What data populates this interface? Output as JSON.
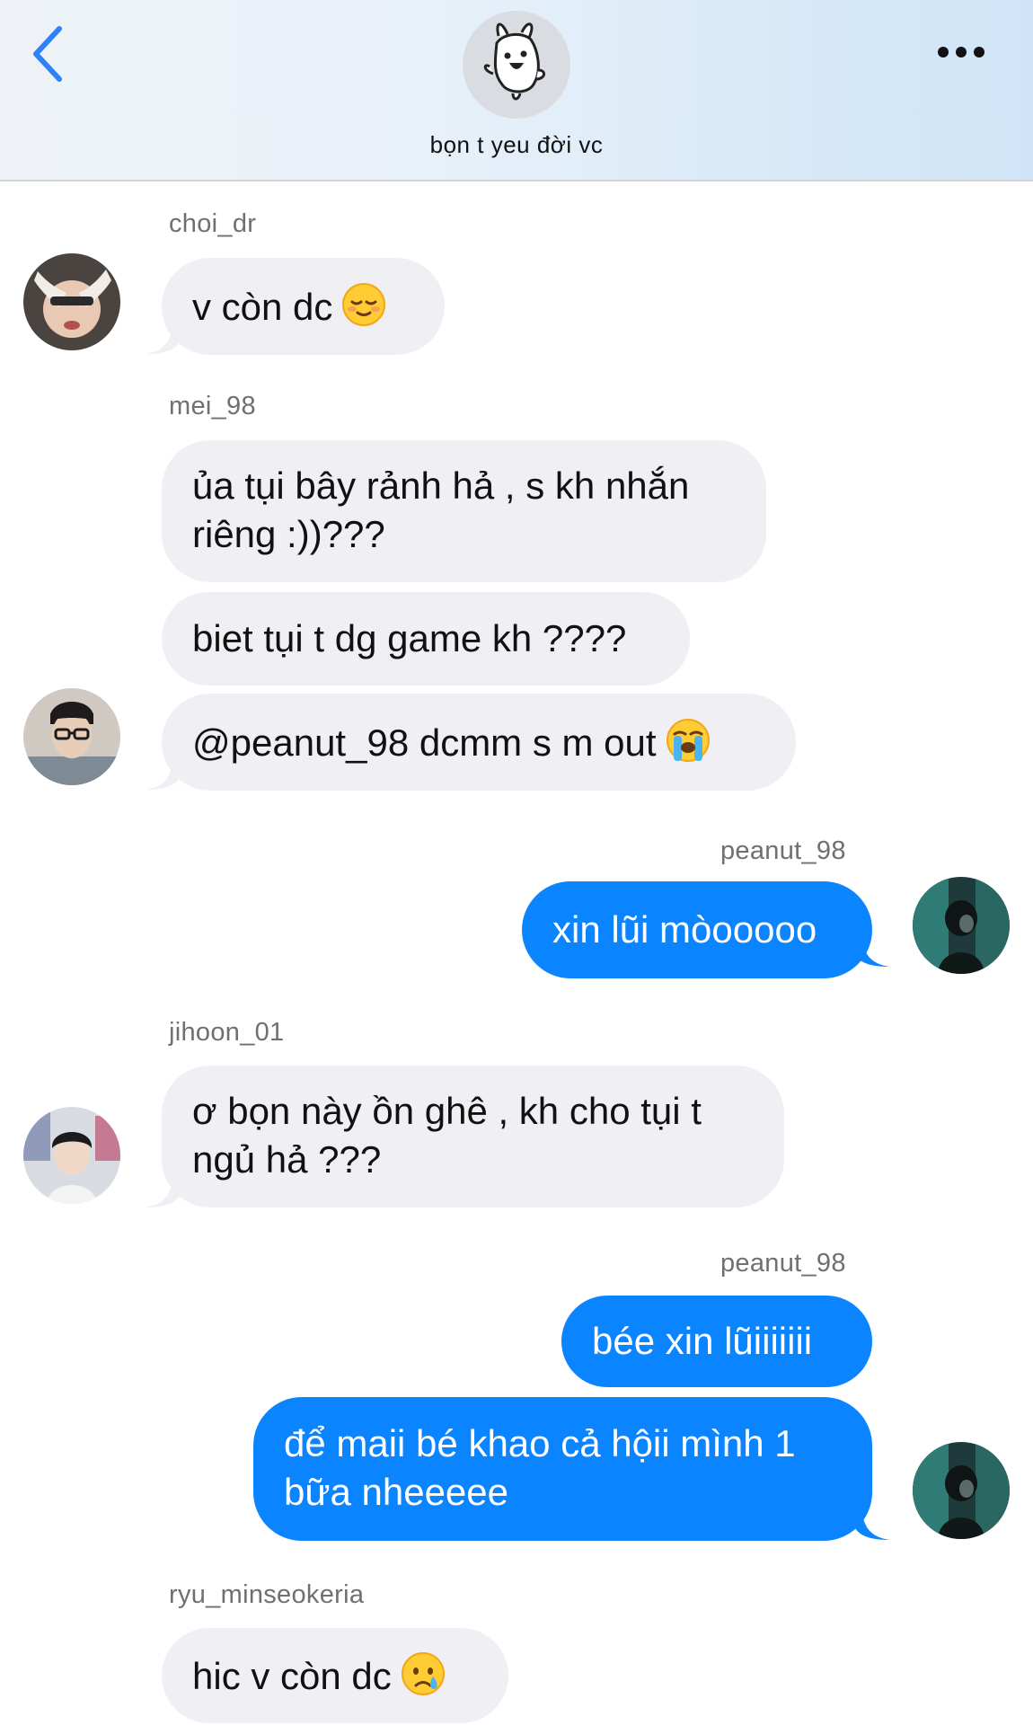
{
  "header": {
    "title": "bọn t yeu đời vc",
    "back_icon": "chevron-left-icon",
    "more_icon": "ellipsis-icon",
    "accent": "#2d83f5"
  },
  "colors": {
    "incoming_bubble": "#efeff4",
    "outgoing_bubble": "#0b84ff",
    "username": "#6f6f74"
  },
  "messages": [
    {
      "sender": "choi_dr",
      "lines": [
        "v còn dc"
      ],
      "emoji": "relieved-face-icon"
    },
    {
      "sender": "mei_98",
      "lines": [
        "ủa tụi bây rảnh hả , s kh nhắn",
        "riêng :))???"
      ]
    },
    {
      "lines": [
        "biet tụi t dg game kh ????"
      ]
    },
    {
      "lines": [
        "@peanut_98 dcmm s m out"
      ],
      "emoji": "loudly-crying-face-icon"
    },
    {
      "sender": "peanut_98",
      "lines": [
        "xin lũi mòooooo"
      ]
    },
    {
      "sender": "jihoon_01",
      "lines": [
        "ơ bọn này ồn ghê , kh cho tụi t",
        "ngủ hả ???"
      ]
    },
    {
      "sender": "peanut_98",
      "lines": [
        "bée xin lũiiiiiii"
      ]
    },
    {
      "lines": [
        "để maii bé khao cả hộii mình 1",
        "bữa nheeeee"
      ]
    },
    {
      "sender": "ryu_minseokeria",
      "lines": [
        "hic v còn dc"
      ],
      "emoji": "crying-face-icon"
    }
  ]
}
